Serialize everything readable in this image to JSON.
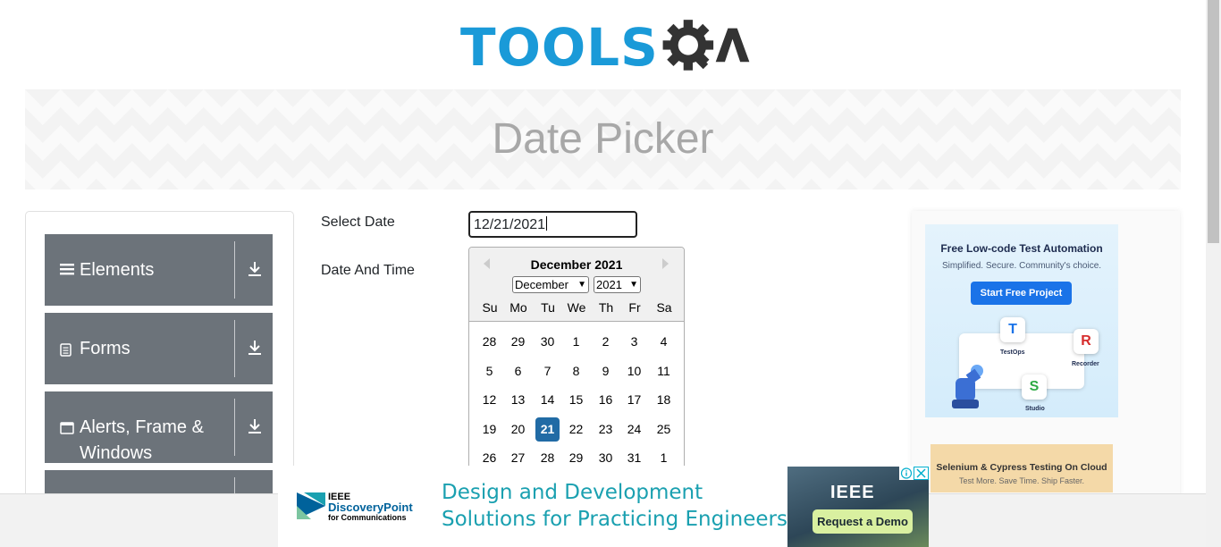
{
  "logo": {
    "text_tools": "TOOLS",
    "text_qa": "QA"
  },
  "banner": {
    "title": "Date Picker"
  },
  "sidebar": {
    "groups": [
      {
        "label": "Elements",
        "icon": "hamburger-icon"
      },
      {
        "label": "Forms",
        "icon": "document-icon"
      },
      {
        "label": "Alerts, Frame & Windows",
        "icon": "window-icon"
      },
      {
        "label": "",
        "icon": ""
      }
    ]
  },
  "form": {
    "select_date_label": "Select Date",
    "date_time_label": "Date And Time",
    "date_value": "12/21/2021"
  },
  "calendar": {
    "header": "December 2021",
    "month_select": "December",
    "year_select": "2021",
    "weekdays": [
      "Su",
      "Mo",
      "Tu",
      "We",
      "Th",
      "Fr",
      "Sa"
    ],
    "weeks": [
      [
        "28",
        "29",
        "30",
        "1",
        "2",
        "3",
        "4"
      ],
      [
        "5",
        "6",
        "7",
        "8",
        "9",
        "10",
        "11"
      ],
      [
        "12",
        "13",
        "14",
        "15",
        "16",
        "17",
        "18"
      ],
      [
        "19",
        "20",
        "21",
        "22",
        "23",
        "24",
        "25"
      ],
      [
        "26",
        "27",
        "28",
        "29",
        "30",
        "31",
        "1"
      ]
    ],
    "selected_day": "21"
  },
  "ads": {
    "right_top": {
      "title": "Free Low-code Test Automation",
      "subtitle": "Simplified. Secure. Community's choice.",
      "button": "Start Free Project",
      "tile_testops": "TestOps",
      "tile_recorder": "Recorder",
      "tile_studio": "Studio"
    },
    "right_bottom": {
      "title": "Selenium & Cypress Testing On Cloud",
      "subtitle": "Test More. Save Time. Ship Faster."
    },
    "bottom": {
      "brand_line1": "IEEE",
      "brand_line2": "DiscoveryPoint",
      "brand_line3": "for Communications",
      "headline1": "Design and Development",
      "headline2": "Solutions for Practicing Engineers",
      "image_brand": "IEEE",
      "cta": "Request a Demo"
    }
  },
  "colors": {
    "logo_blue": "#1a9ad8",
    "sidebar_group": "#6c737a",
    "selected_day": "#216ba5",
    "ad_teal": "#1aa0b0"
  }
}
